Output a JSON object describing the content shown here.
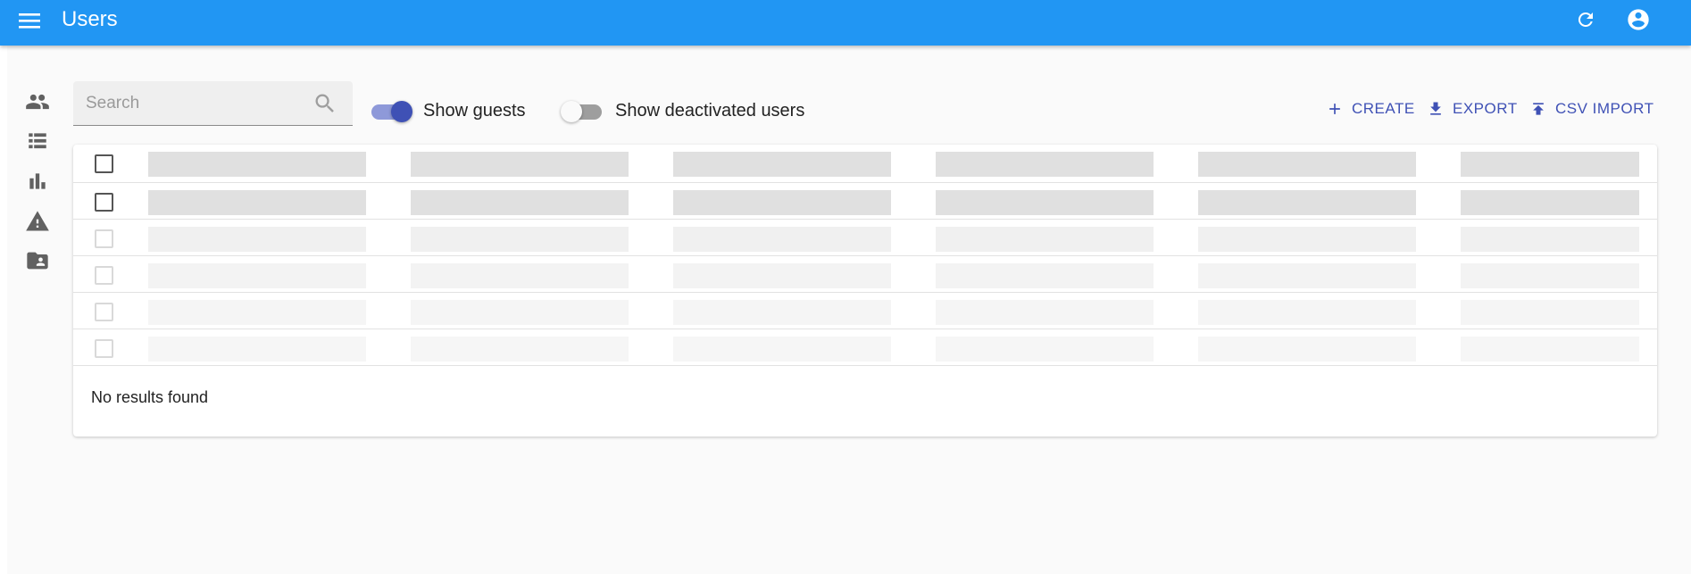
{
  "app": {
    "title": "Users",
    "colors": {
      "appbar": "#2196f3",
      "accent": "#3f51b5",
      "toggle_on_track": "#8e99d9",
      "toggle_off_track": "#9e9e9e"
    }
  },
  "header_icons": [
    "menu-icon",
    "refresh-icon",
    "account-circle-icon"
  ],
  "sidebar": {
    "items": [
      {
        "name": "users",
        "icon": "people-icon"
      },
      {
        "name": "lists",
        "icon": "list-icon"
      },
      {
        "name": "statistics",
        "icon": "bar-chart-icon"
      },
      {
        "name": "reports",
        "icon": "warning-icon"
      },
      {
        "name": "media",
        "icon": "folder-shared-icon"
      }
    ]
  },
  "search": {
    "placeholder": "Search",
    "value": ""
  },
  "filters": {
    "show_guests": {
      "label": "Show guests",
      "checked": true
    },
    "show_deactivated": {
      "label": "Show deactivated users",
      "checked": false
    }
  },
  "actions": {
    "create": "CREATE",
    "export": "EXPORT",
    "csv_import": "CSV IMPORT"
  },
  "table": {
    "loading": true,
    "empty_message": "No results found"
  }
}
